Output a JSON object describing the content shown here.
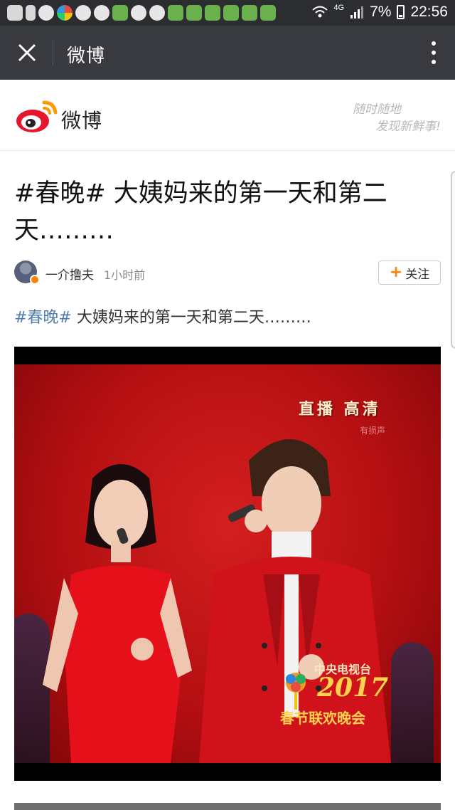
{
  "status_bar": {
    "network": "4G",
    "battery": "7%",
    "time": "22:56"
  },
  "app_bar": {
    "title": "微博"
  },
  "weibo_header": {
    "brand": "微博",
    "slogan_line1": "随时随地",
    "slogan_line2": "发现新鲜事!"
  },
  "article": {
    "title": "#春晚# 大姨妈来的第一天和第二天………",
    "author": "一介撸夫",
    "time": "1小时前",
    "follow_label": "关注",
    "hashtag": "#春晚#",
    "body_text": " 大姨妈来的第一天和第二天………"
  },
  "video": {
    "overlay_hd": "直播 高清",
    "overlay_sub": "有损声",
    "gala_cctv": "中央电视台",
    "gala_year": "2017",
    "gala_name": "春节联欢晚会"
  },
  "colors": {
    "status_bar_bg": "#2b2d30",
    "app_bar_bg": "#393a3f",
    "weibo_orange": "#ff8200",
    "hashtag_blue": "#507daf",
    "stage_red": "#c4161c"
  },
  "icons": [
    "close-icon",
    "more-vertical-icon",
    "weibo-logo-icon",
    "plus-icon",
    "signal-icon",
    "battery-icon",
    "wifi-icon"
  ]
}
